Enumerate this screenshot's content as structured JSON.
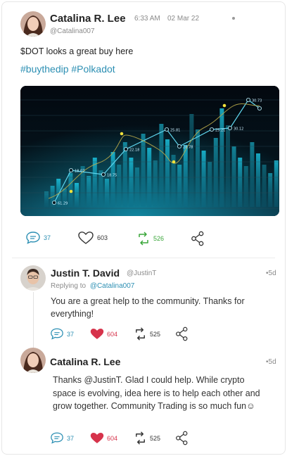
{
  "post": {
    "author_name": "Catalina R. Lee",
    "time": "6:33 AM",
    "date": "02 Mar 22",
    "handle": "@Catalina007",
    "text": "$DOT looks a great buy here",
    "hashtags": "#buythedip #Polkadot",
    "chart_labels": [
      "61.29",
      "18.07",
      "18.75",
      "22.18",
      "25.81",
      "28.78",
      "25.21",
      "30.12",
      "30.73"
    ],
    "actions": {
      "comments": "37",
      "likes": "603",
      "retweets": "526"
    }
  },
  "replies": [
    {
      "author_name": "Justin T. David",
      "handle": "@JustinT",
      "age": "5d",
      "replying_label": "Replying to",
      "replying_to": "@Catalina007",
      "text": "You are a great help to the community. Thanks for everything!",
      "comments": "37",
      "likes": "604",
      "retweets": "525"
    },
    {
      "author_name": "Catalina R. Lee",
      "age": "5d",
      "text": "Thanks @JustinT. Glad I could help. While crypto space is evolving, idea here is to help each other and grow together. Community Trading is so much fun☺",
      "comments": "37",
      "likes": "604",
      "retweets": "525"
    }
  ],
  "colors": {
    "accent": "#2c8fb3",
    "heart": "#d6334b",
    "retweet_green": "#3aa63a"
  }
}
